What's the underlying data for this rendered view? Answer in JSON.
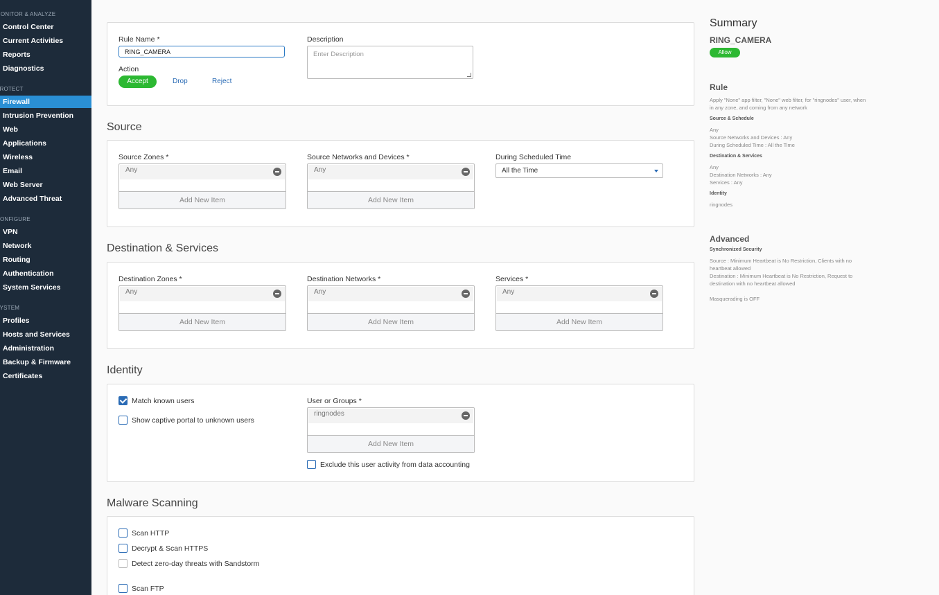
{
  "sidebar": {
    "sections": [
      {
        "title": "MONITOR & ANALYZE",
        "items": [
          "Control Center",
          "Current Activities",
          "Reports",
          "Diagnostics"
        ]
      },
      {
        "title": "PROTECT",
        "items": [
          "Firewall",
          "Intrusion Prevention",
          "Web",
          "Applications",
          "Wireless",
          "Email",
          "Web Server",
          "Advanced Threat"
        ]
      },
      {
        "title": "CONFIGURE",
        "items": [
          "VPN",
          "Network",
          "Routing",
          "Authentication",
          "System Services"
        ]
      },
      {
        "title": "SYSTEM",
        "items": [
          "Profiles",
          "Hosts and Services",
          "Administration",
          "Backup & Firmware",
          "Certificates"
        ]
      }
    ],
    "active_item": "Firewall"
  },
  "rule": {
    "name_label": "Rule Name *",
    "name_value": "RING_CAMERA",
    "description_label": "Description",
    "description_placeholder": "Enter Description",
    "action_label": "Action",
    "actions": [
      "Accept",
      "Drop",
      "Reject"
    ],
    "selected_action": "Accept"
  },
  "source": {
    "title": "Source",
    "zones_label": "Source Zones *",
    "zones_value": "Any",
    "networks_label": "Source Networks and Devices *",
    "networks_value": "Any",
    "schedule_label": "During Scheduled Time",
    "schedule_value": "All the Time",
    "add_label": "Add New Item"
  },
  "destination": {
    "title": "Destination & Services",
    "zones_label": "Destination Zones *",
    "zones_value": "Any",
    "networks_label": "Destination Networks *",
    "networks_value": "Any",
    "services_label": "Services *",
    "services_value": "Any",
    "add_label": "Add New Item"
  },
  "identity": {
    "title": "Identity",
    "match_known_users": "Match known users",
    "match_known_users_checked": true,
    "captive_portal": "Show captive portal to unknown users",
    "users_label": "User or Groups *",
    "users_value": "ringnodes",
    "add_label": "Add New Item",
    "exclude_label": "Exclude this user activity from data accounting"
  },
  "malware": {
    "title": "Malware Scanning",
    "scan_http": "Scan HTTP",
    "decrypt_https": "Decrypt & Scan HTTPS",
    "zero_day": "Detect zero-day threats with Sandstorm",
    "scan_ftp": "Scan FTP"
  },
  "summary": {
    "title": "Summary",
    "rule_name": "RING_CAMERA",
    "badge": "Allow",
    "rule_heading": "Rule",
    "rule_text": "Apply \"None\" app filter, \"None\" web filter, for \"ringnodes\" user, when in any zone, and coming from any network",
    "source_schedule_heading": "Source & Schedule",
    "source_line1": "Any",
    "source_line2": "Source Networks and Devices : Any",
    "source_line3": "During Scheduled Time : All the Time",
    "dest_heading": "Destination & Services",
    "dest_line1": "Any",
    "dest_line2": "Destination Networks : Any",
    "dest_line3": "Services : Any",
    "identity_heading": "Identity",
    "identity_line1": "ringnodes",
    "advanced_heading": "Advanced",
    "sync_heading": "Synchronized Security",
    "sync_source": "Source : Minimum Heartbeat is No Restriction, Clients with no heartbeat allowed",
    "sync_dest": "Destination : Minimum Heartbeat is No Restriction, Request to destination with no heartbeat allowed",
    "masquerading": "Masquerading is OFF"
  },
  "colors": {
    "sidebar_bg": "#1d2b3a",
    "active": "#2a8fd4",
    "accept_green": "#2cb832",
    "link_blue": "#2a6bb5"
  }
}
